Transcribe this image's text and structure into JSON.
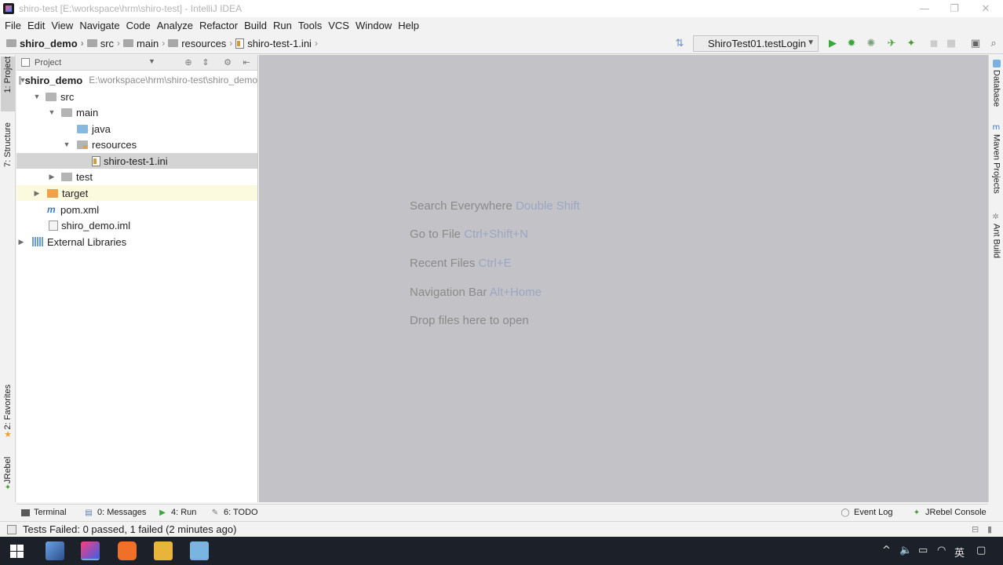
{
  "window": {
    "title": "shiro-test [E:\\workspace\\hrm\\shiro-test] - IntelliJ IDEA",
    "controls": {
      "minimize": "—",
      "restore": "❐",
      "close": "✕"
    }
  },
  "menu": [
    "File",
    "Edit",
    "View",
    "Navigate",
    "Code",
    "Analyze",
    "Refactor",
    "Build",
    "Run",
    "Tools",
    "VCS",
    "Window",
    "Help"
  ],
  "breadcrumb": [
    "shiro_demo",
    "src",
    "main",
    "resources",
    "shiro-test-1.ini"
  ],
  "run_config": {
    "label": "ShiroTest01.testLogin"
  },
  "left_tabs": {
    "project": "1: Project",
    "structure": "7: Structure",
    "favorites": "2: Favorites",
    "jrebel": "JRebel"
  },
  "right_tabs": {
    "database": "Database",
    "maven": "Maven Projects",
    "ant": "Ant Build"
  },
  "project_panel": {
    "header": "Project",
    "tree": [
      {
        "label": "shiro_demo",
        "hint": "E:\\workspace\\hrm\\shiro-test\\shiro_demo"
      },
      {
        "label": "src"
      },
      {
        "label": "main"
      },
      {
        "label": "java"
      },
      {
        "label": "resources"
      },
      {
        "label": "shiro-test-1.ini"
      },
      {
        "label": "test"
      },
      {
        "label": "target"
      },
      {
        "label": "pom.xml"
      },
      {
        "label": "shiro_demo.iml"
      },
      {
        "label": "External Libraries"
      }
    ]
  },
  "editor_hints": [
    {
      "text": "Search Everywhere",
      "key": "Double Shift"
    },
    {
      "text": "Go to File",
      "key": "Ctrl+Shift+N"
    },
    {
      "text": "Recent Files",
      "key": "Ctrl+E"
    },
    {
      "text": "Navigation Bar",
      "key": "Alt+Home"
    },
    {
      "text": "Drop files here to open",
      "key": ""
    }
  ],
  "bottom_tabs": {
    "terminal": "Terminal",
    "messages": "0: Messages",
    "run": "4: Run",
    "todo": "6: TODO",
    "event_log": "Event Log",
    "jrebel_console": "JRebel Console"
  },
  "status": {
    "message": "Tests Failed: 0 passed, 1 failed (2 minutes ago)"
  },
  "taskbar": {
    "ime": "英"
  },
  "colors": {
    "editor_bg": "#c3c3c7",
    "selection": "#d4d4d4",
    "run_green": "#3aa63a",
    "taskbar_bg": "#1c2029"
  }
}
